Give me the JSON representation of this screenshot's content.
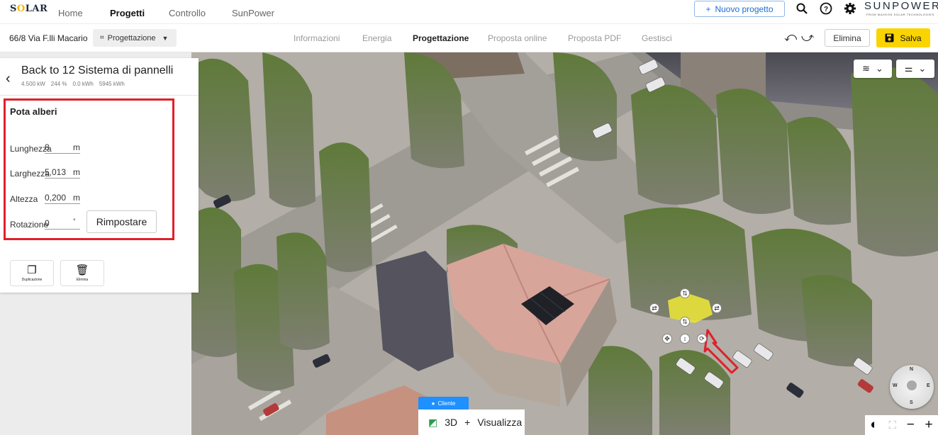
{
  "topnav": {
    "logo": "SOLAR",
    "items": [
      {
        "label": "Home",
        "active": false
      },
      {
        "label": "Progetti",
        "active": true
      },
      {
        "label": "Controllo",
        "active": false
      },
      {
        "label": "SunPower",
        "active": false
      }
    ],
    "new_project_label": "Nuovo progetto",
    "brand": "SUNPOWER",
    "brand_sub": "FROM MAXEON SOLAR TECHNOLOGIES",
    "icons": [
      "search-icon",
      "help-icon",
      "settings-icon"
    ]
  },
  "subbar": {
    "address": "66/8 Via F.lli Macario",
    "mode_label": "Progettazione",
    "tabs": [
      {
        "label": "Informazioni",
        "active": false
      },
      {
        "label": "Energia",
        "active": false
      },
      {
        "label": "Progettazione",
        "active": true
      },
      {
        "label": "Proposta online",
        "active": false
      },
      {
        "label": "Proposta PDF",
        "active": false
      },
      {
        "label": "Gestisci",
        "active": false
      }
    ],
    "delete_label": "Elimina",
    "save_label": "Salva"
  },
  "panel": {
    "back_title": "Back to 12 Sistema di pannelli",
    "stats": [
      "4.500 kW",
      "244 %",
      "0.0 kWh",
      "5945 kWh"
    ],
    "section_title": "Pota alberi",
    "fields": [
      {
        "label": "Lunghezza",
        "value": "8",
        "unit": "m"
      },
      {
        "label": "Larghezza",
        "value": "5,013",
        "unit": "m"
      },
      {
        "label": "Altezza",
        "value": "0,200",
        "unit": "m"
      },
      {
        "label": "Rotazione",
        "value": "0",
        "unit": "°"
      }
    ],
    "reset_label": "Rimpostare",
    "actions": [
      {
        "label": "Duplicazione",
        "icon": "copy-icon"
      },
      {
        "label": "Elimina",
        "icon": "trash-icon"
      }
    ]
  },
  "map": {
    "view_pill_label": "Cliente",
    "view_mode": "3D",
    "view_toggle_label": "Visualizza",
    "compass": [
      "N",
      "E",
      "S",
      "W"
    ]
  },
  "colors": {
    "accent_blue": "#1a6fd1",
    "save_yellow": "#fad400",
    "highlight_red": "#e0202a",
    "selection_yellow": "#e8e23a"
  }
}
